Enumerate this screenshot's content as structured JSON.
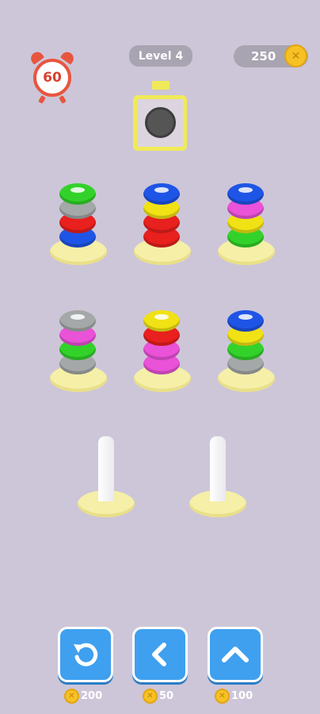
{
  "timer": {
    "seconds": "60",
    "color": "#e8553f"
  },
  "level": {
    "label": "Level 4"
  },
  "coins": {
    "amount": "250",
    "icon": "coin-icon"
  },
  "colors": {
    "green": "#33d22a",
    "gray": "#a4a8a8",
    "red": "#e8201e",
    "blue": "#1f55e6",
    "yellow": "#f0e214",
    "magenta": "#ea52d8"
  },
  "poles": [
    {
      "rings": [
        "blue",
        "red",
        "gray",
        "green"
      ]
    },
    {
      "rings": [
        "red",
        "red",
        "yellow",
        "blue"
      ]
    },
    {
      "rings": [
        "green",
        "yellow",
        "magenta",
        "blue"
      ]
    },
    {
      "rings": [
        "gray",
        "green",
        "magenta",
        "gray"
      ]
    },
    {
      "rings": [
        "magenta",
        "magenta",
        "red",
        "yellow"
      ]
    },
    {
      "rings": [
        "gray",
        "green",
        "yellow",
        "blue"
      ]
    },
    {
      "rings": []
    },
    {
      "rings": []
    }
  ],
  "buttons": [
    {
      "name": "undo",
      "icon": "undo-arrow-icon",
      "price": "200"
    },
    {
      "name": "back",
      "icon": "chevron-left-icon",
      "price": "50"
    },
    {
      "name": "add-pole",
      "icon": "chevron-up-icon",
      "price": "100"
    }
  ]
}
